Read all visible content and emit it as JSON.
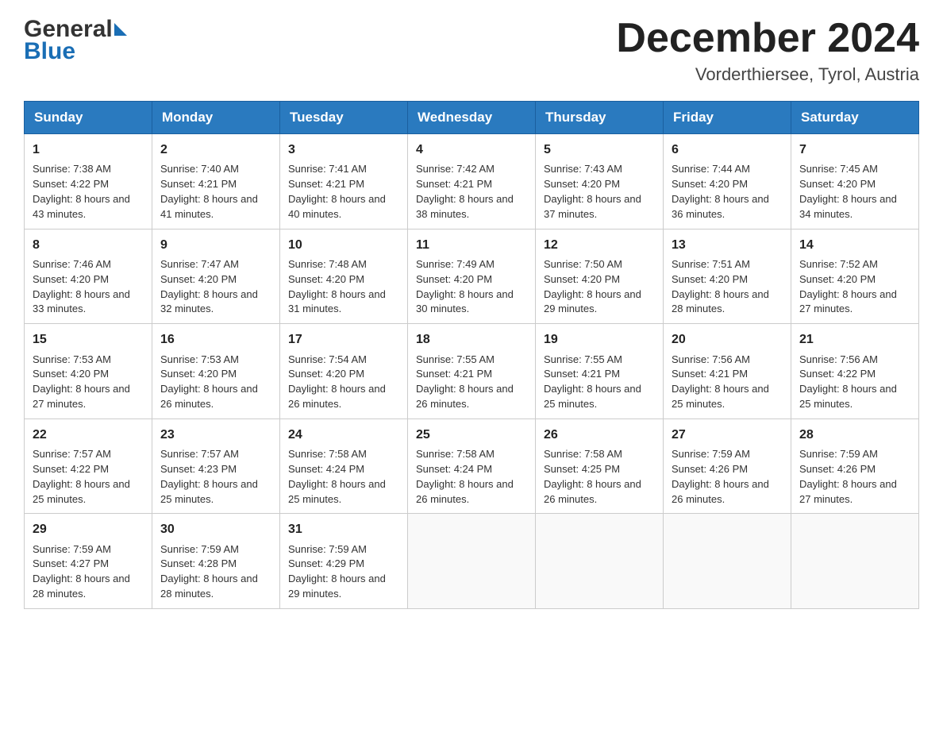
{
  "logo": {
    "general": "General",
    "blue": "Blue"
  },
  "title": {
    "month": "December 2024",
    "location": "Vorderthiersee, Tyrol, Austria"
  },
  "days_of_week": [
    "Sunday",
    "Monday",
    "Tuesday",
    "Wednesday",
    "Thursday",
    "Friday",
    "Saturday"
  ],
  "weeks": [
    [
      {
        "day": "1",
        "sunrise": "7:38 AM",
        "sunset": "4:22 PM",
        "daylight": "8 hours and 43 minutes."
      },
      {
        "day": "2",
        "sunrise": "7:40 AM",
        "sunset": "4:21 PM",
        "daylight": "8 hours and 41 minutes."
      },
      {
        "day": "3",
        "sunrise": "7:41 AM",
        "sunset": "4:21 PM",
        "daylight": "8 hours and 40 minutes."
      },
      {
        "day": "4",
        "sunrise": "7:42 AM",
        "sunset": "4:21 PM",
        "daylight": "8 hours and 38 minutes."
      },
      {
        "day": "5",
        "sunrise": "7:43 AM",
        "sunset": "4:20 PM",
        "daylight": "8 hours and 37 minutes."
      },
      {
        "day": "6",
        "sunrise": "7:44 AM",
        "sunset": "4:20 PM",
        "daylight": "8 hours and 36 minutes."
      },
      {
        "day": "7",
        "sunrise": "7:45 AM",
        "sunset": "4:20 PM",
        "daylight": "8 hours and 34 minutes."
      }
    ],
    [
      {
        "day": "8",
        "sunrise": "7:46 AM",
        "sunset": "4:20 PM",
        "daylight": "8 hours and 33 minutes."
      },
      {
        "day": "9",
        "sunrise": "7:47 AM",
        "sunset": "4:20 PM",
        "daylight": "8 hours and 32 minutes."
      },
      {
        "day": "10",
        "sunrise": "7:48 AM",
        "sunset": "4:20 PM",
        "daylight": "8 hours and 31 minutes."
      },
      {
        "day": "11",
        "sunrise": "7:49 AM",
        "sunset": "4:20 PM",
        "daylight": "8 hours and 30 minutes."
      },
      {
        "day": "12",
        "sunrise": "7:50 AM",
        "sunset": "4:20 PM",
        "daylight": "8 hours and 29 minutes."
      },
      {
        "day": "13",
        "sunrise": "7:51 AM",
        "sunset": "4:20 PM",
        "daylight": "8 hours and 28 minutes."
      },
      {
        "day": "14",
        "sunrise": "7:52 AM",
        "sunset": "4:20 PM",
        "daylight": "8 hours and 27 minutes."
      }
    ],
    [
      {
        "day": "15",
        "sunrise": "7:53 AM",
        "sunset": "4:20 PM",
        "daylight": "8 hours and 27 minutes."
      },
      {
        "day": "16",
        "sunrise": "7:53 AM",
        "sunset": "4:20 PM",
        "daylight": "8 hours and 26 minutes."
      },
      {
        "day": "17",
        "sunrise": "7:54 AM",
        "sunset": "4:20 PM",
        "daylight": "8 hours and 26 minutes."
      },
      {
        "day": "18",
        "sunrise": "7:55 AM",
        "sunset": "4:21 PM",
        "daylight": "8 hours and 26 minutes."
      },
      {
        "day": "19",
        "sunrise": "7:55 AM",
        "sunset": "4:21 PM",
        "daylight": "8 hours and 25 minutes."
      },
      {
        "day": "20",
        "sunrise": "7:56 AM",
        "sunset": "4:21 PM",
        "daylight": "8 hours and 25 minutes."
      },
      {
        "day": "21",
        "sunrise": "7:56 AM",
        "sunset": "4:22 PM",
        "daylight": "8 hours and 25 minutes."
      }
    ],
    [
      {
        "day": "22",
        "sunrise": "7:57 AM",
        "sunset": "4:22 PM",
        "daylight": "8 hours and 25 minutes."
      },
      {
        "day": "23",
        "sunrise": "7:57 AM",
        "sunset": "4:23 PM",
        "daylight": "8 hours and 25 minutes."
      },
      {
        "day": "24",
        "sunrise": "7:58 AM",
        "sunset": "4:24 PM",
        "daylight": "8 hours and 25 minutes."
      },
      {
        "day": "25",
        "sunrise": "7:58 AM",
        "sunset": "4:24 PM",
        "daylight": "8 hours and 26 minutes."
      },
      {
        "day": "26",
        "sunrise": "7:58 AM",
        "sunset": "4:25 PM",
        "daylight": "8 hours and 26 minutes."
      },
      {
        "day": "27",
        "sunrise": "7:59 AM",
        "sunset": "4:26 PM",
        "daylight": "8 hours and 26 minutes."
      },
      {
        "day": "28",
        "sunrise": "7:59 AM",
        "sunset": "4:26 PM",
        "daylight": "8 hours and 27 minutes."
      }
    ],
    [
      {
        "day": "29",
        "sunrise": "7:59 AM",
        "sunset": "4:27 PM",
        "daylight": "8 hours and 28 minutes."
      },
      {
        "day": "30",
        "sunrise": "7:59 AM",
        "sunset": "4:28 PM",
        "daylight": "8 hours and 28 minutes."
      },
      {
        "day": "31",
        "sunrise": "7:59 AM",
        "sunset": "4:29 PM",
        "daylight": "8 hours and 29 minutes."
      },
      null,
      null,
      null,
      null
    ]
  ]
}
